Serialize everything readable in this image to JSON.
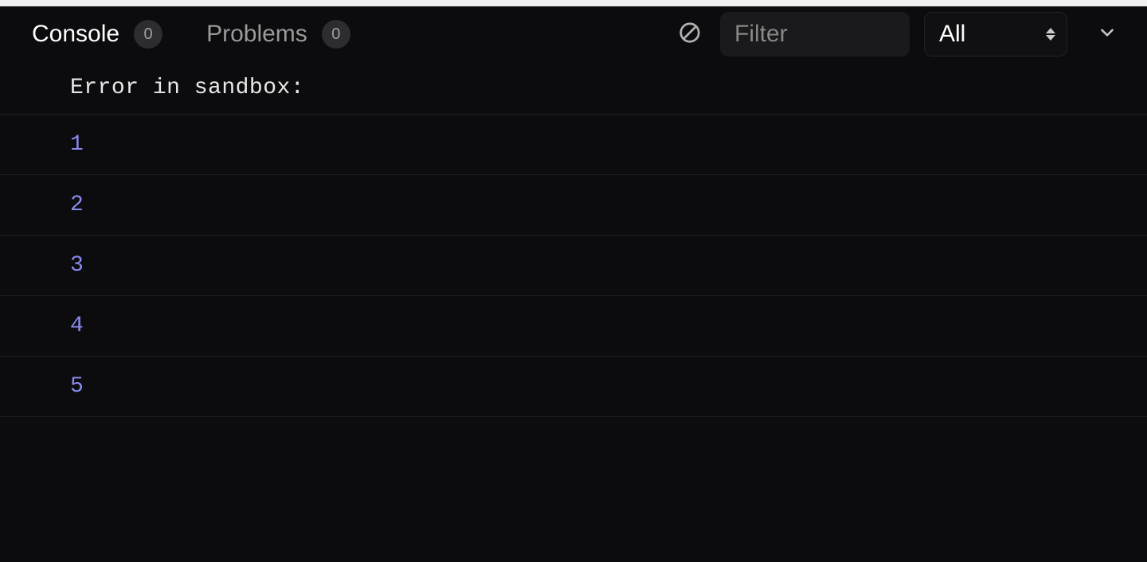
{
  "toolbar": {
    "tabs": [
      {
        "label": "Console",
        "badge": "0",
        "active": true
      },
      {
        "label": "Problems",
        "badge": "0",
        "active": false
      }
    ],
    "filter_placeholder": "Filter",
    "filter_value": "",
    "level_selected": "All",
    "level_options": [
      "All"
    ]
  },
  "console": {
    "rows": [
      {
        "type": "message",
        "text": "Error in sandbox:"
      },
      {
        "type": "number",
        "text": "1"
      },
      {
        "type": "number",
        "text": "2"
      },
      {
        "type": "number",
        "text": "3"
      },
      {
        "type": "number",
        "text": "4"
      },
      {
        "type": "number",
        "text": "5"
      }
    ]
  }
}
